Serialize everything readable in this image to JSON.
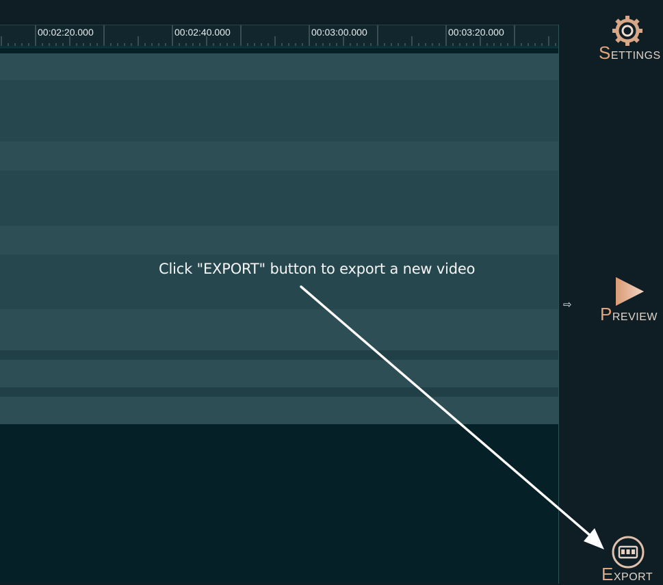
{
  "timeline": {
    "ruler_labels": [
      "00:02:20.000",
      "00:02:40.000",
      "00:03:00.000",
      "00:03:20.000"
    ]
  },
  "sidebar": {
    "settings": {
      "initial": "S",
      "rest": "ETTINGS",
      "icon": "gear-icon"
    },
    "preview": {
      "initial": "P",
      "rest": "REVIEW",
      "icon": "play-icon"
    },
    "export": {
      "initial": "E",
      "rest": "XPORT",
      "icon": "film-icon"
    }
  },
  "annotation": {
    "tooltip": "Click \"EXPORT\" button to export a new video",
    "pointer_glyph": "⇨"
  },
  "colors": {
    "accent": "#e3a57c",
    "label": "#e1d4c8",
    "background": "#0e1e24",
    "track_light": "#2d4e55",
    "track_dark": "#27474f"
  }
}
